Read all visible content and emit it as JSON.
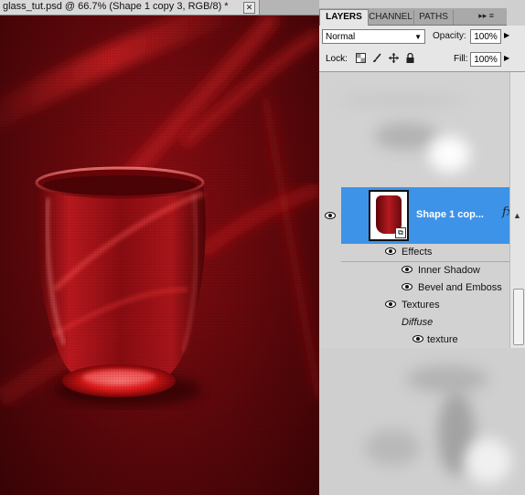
{
  "document": {
    "tab_title": "glass_tut.psd @ 66.7% (Shape 1 copy 3, RGB/8) *",
    "close_glyph": "✕"
  },
  "panel": {
    "tabs": [
      {
        "label": "LAYERS",
        "active": true
      },
      {
        "label": "CHANNEL",
        "active": false
      },
      {
        "label": "PATHS",
        "active": false
      }
    ],
    "menu_glyph": "▸▸ ≡",
    "blend_mode": "Normal",
    "opacity_label": "Opacity:",
    "opacity_value": "100%",
    "lock_label": "Lock:",
    "fill_label": "Fill:",
    "fill_value": "100%"
  },
  "layers": {
    "selected_layer_name": "Shape 1 cop...",
    "fx_label": "fx",
    "effects_label": "Effects",
    "effects": [
      {
        "name": "Inner Shadow"
      },
      {
        "name": "Bevel and Emboss"
      }
    ],
    "textures_label": "Textures",
    "diffuse_label": "Diffuse",
    "texture_item": "texture"
  },
  "colors": {
    "canvas_red": "#6a0a0e",
    "selection_blue": "#3d93e8"
  }
}
